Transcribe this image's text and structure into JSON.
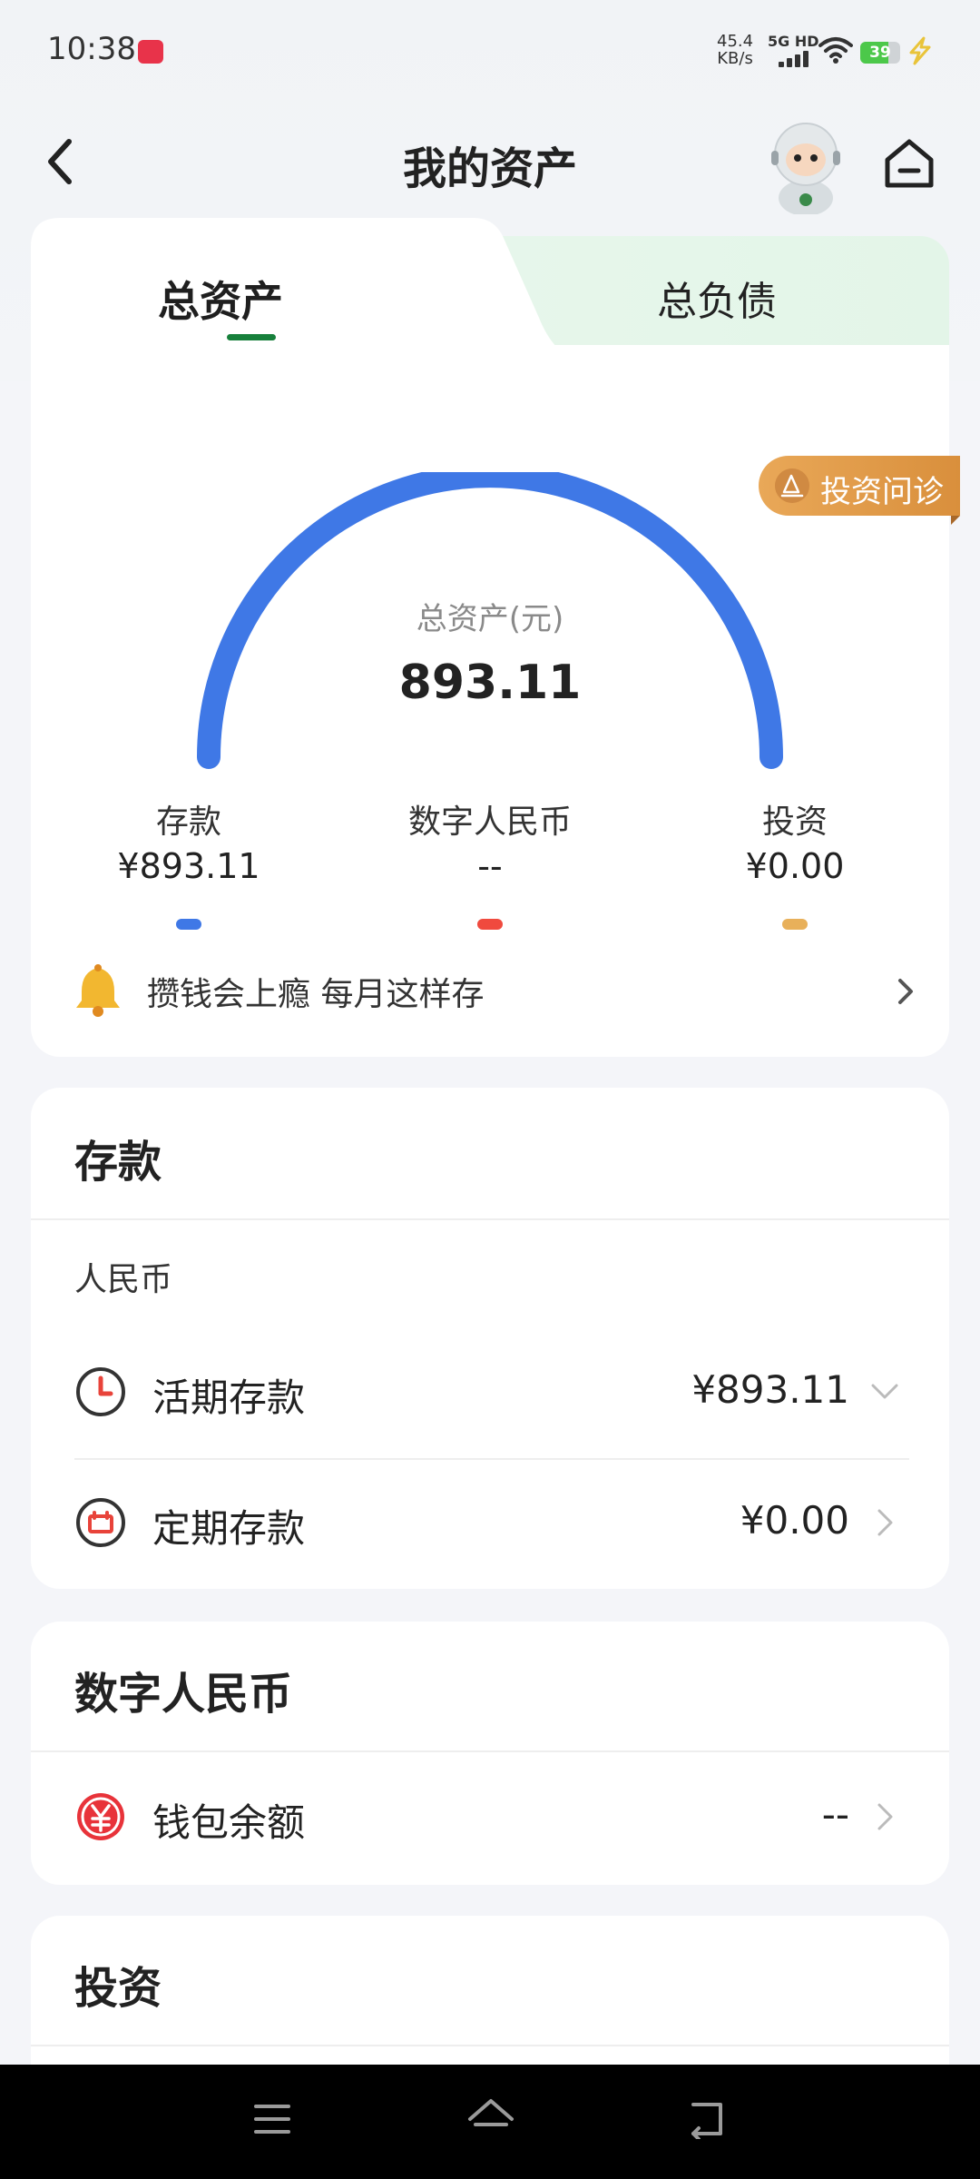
{
  "status_bar": {
    "time": "10:38",
    "app_badge": "小红书",
    "net_speed_value": "45.4",
    "net_speed_unit": "KB/s",
    "signal_label": "5G HD",
    "battery": "39"
  },
  "header": {
    "title": "我的资产",
    "back_icon": "chevron-left-icon",
    "home_icon": "home-icon",
    "avatar_icon": "robot-avatar"
  },
  "tabs": {
    "active": "总资产",
    "inactive": "总负债"
  },
  "consult_badge": {
    "label": "投资问诊"
  },
  "gauge": {
    "label": "总资产(元)",
    "value": "893.11",
    "color": "#3f78e6",
    "fill_fraction": 1.0
  },
  "legend": [
    {
      "name": "存款",
      "value": "¥893.11",
      "color": "#3f78e6"
    },
    {
      "name": "数字人民币",
      "value": "--",
      "color": "#f04a3e"
    },
    {
      "name": "投资",
      "value": "¥0.00",
      "color": "#e8b05a"
    }
  ],
  "promo": {
    "text": "攒钱会上瘾 每月这样存"
  },
  "deposit_section": {
    "title": "存款",
    "currency": "人民币",
    "rows": [
      {
        "label": "活期存款",
        "value": "¥893.11",
        "icon": "clock-icon",
        "chevron": "chevron-down-icon"
      },
      {
        "label": "定期存款",
        "value": "¥0.00",
        "icon": "calendar-icon",
        "chevron": "chevron-right-icon"
      }
    ]
  },
  "ecny_section": {
    "title": "数字人民币",
    "rows": [
      {
        "label": "钱包余额",
        "value": "--",
        "icon": "ecny-yuan-icon",
        "chevron": "chevron-right-icon"
      }
    ]
  },
  "invest_section": {
    "title": "投资"
  }
}
